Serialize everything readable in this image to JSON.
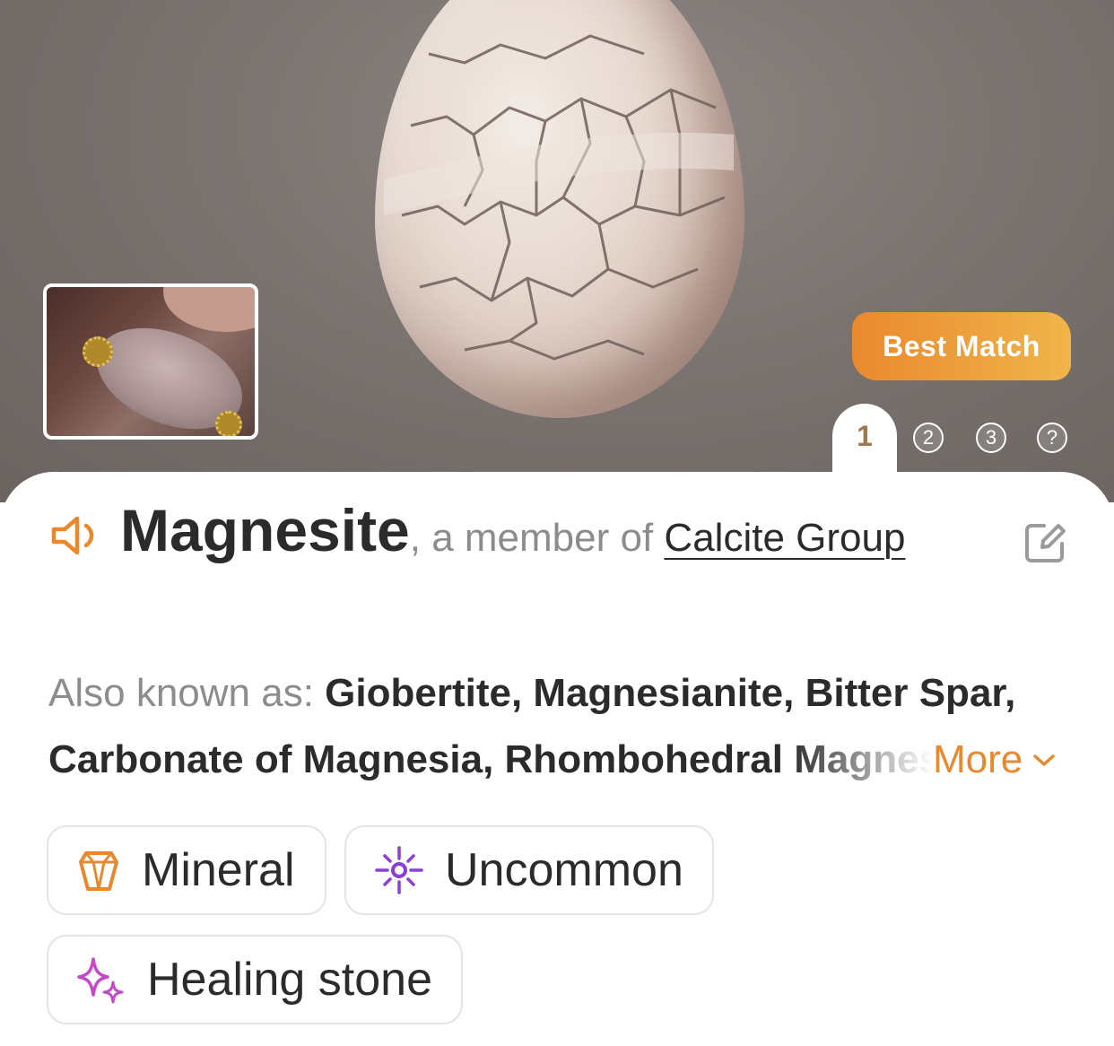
{
  "hero": {
    "badge": "Best Match",
    "pages": [
      "1",
      "2",
      "3",
      "?"
    ]
  },
  "result": {
    "name": "Magnesite",
    "member_prefix": ", a member of ",
    "group": "Calcite Group"
  },
  "aka": {
    "label": "Also known as: ",
    "value": "Giobertite, Magnesianite, Bitter Spar, Carbonate of Magnesia, Rhombohedral Magnesite",
    "more": "More"
  },
  "tags": [
    {
      "label": "Mineral",
      "icon": "crystal-icon",
      "color": "#e8892f"
    },
    {
      "label": "Uncommon",
      "icon": "sparkle-rarity-icon",
      "color": "#8b3fd6"
    },
    {
      "label": "Healing stone",
      "icon": "sparkles-icon",
      "color": "#c448c7"
    }
  ],
  "colors": {
    "accent": "#e8892f",
    "text": "#2b2b2b",
    "muted": "#8c8c8c"
  }
}
